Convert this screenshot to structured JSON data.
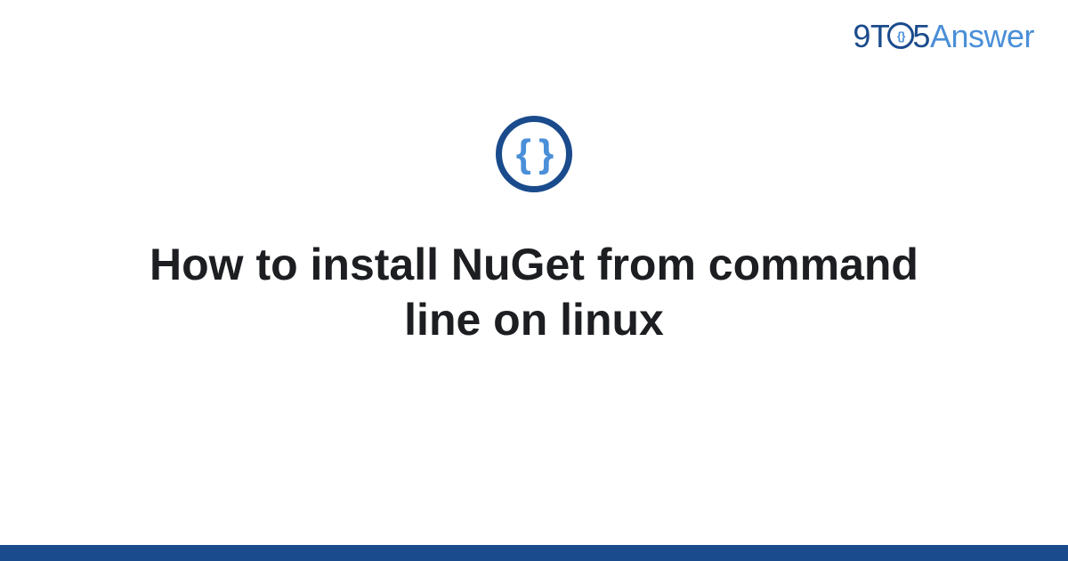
{
  "brand": {
    "part_9t": "9T",
    "part_o_inner": "{}",
    "part_5": "5",
    "part_answer": "Answer"
  },
  "icon": {
    "name": "code-braces-icon",
    "glyph": "{ }"
  },
  "title": "How to install NuGet from command line on linux",
  "colors": {
    "primary": "#1a4b8c",
    "accent": "#4a8fd8"
  }
}
